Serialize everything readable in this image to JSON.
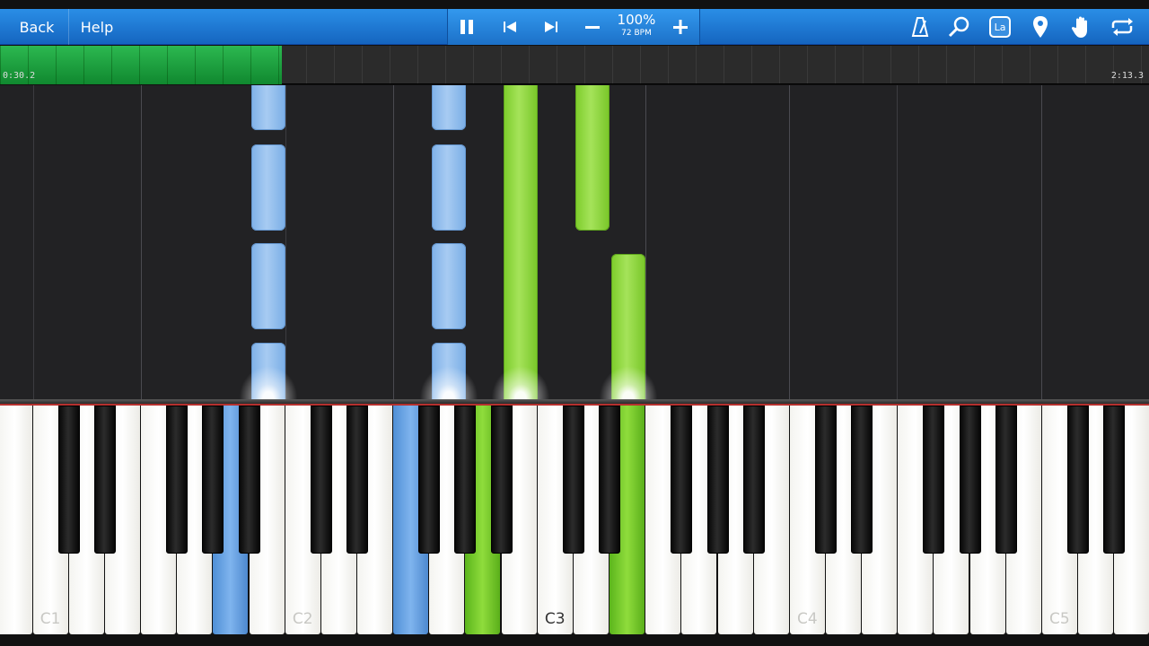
{
  "toolbar": {
    "back_label": "Back",
    "help_label": "Help",
    "pause_icon": "pause-icon",
    "prev_icon": "skip-back-icon",
    "next_icon": "skip-forward-icon",
    "zoom_out_icon": "minus-icon",
    "zoom_in_icon": "plus-icon",
    "speed_percent": "100%",
    "tempo": "72 BPM",
    "right_icons": [
      "metronome-icon",
      "magnifier-icon",
      "note-label-icon",
      "location-pin-icon",
      "hand-icon",
      "loop-icon"
    ],
    "note_label_text": "La"
  },
  "timeline": {
    "current_time": "0:30.2",
    "total_time": "2:13.3",
    "progress_fraction": 0.245
  },
  "keyboard": {
    "labels": [
      "C1",
      "C2",
      "C3",
      "C4",
      "C5"
    ],
    "active_keys": [
      {
        "note": "A1",
        "hand": "left"
      },
      {
        "note": "F2",
        "hand": "left"
      },
      {
        "note": "A2",
        "hand": "right"
      },
      {
        "note": "E3",
        "hand": "right"
      }
    ]
  },
  "colors": {
    "toolbar": "#1e7ad8",
    "left_hand": "#7fb1e8",
    "right_hand": "#8fd43c",
    "progress": "#1fa33f",
    "roll_background": "#222224"
  }
}
